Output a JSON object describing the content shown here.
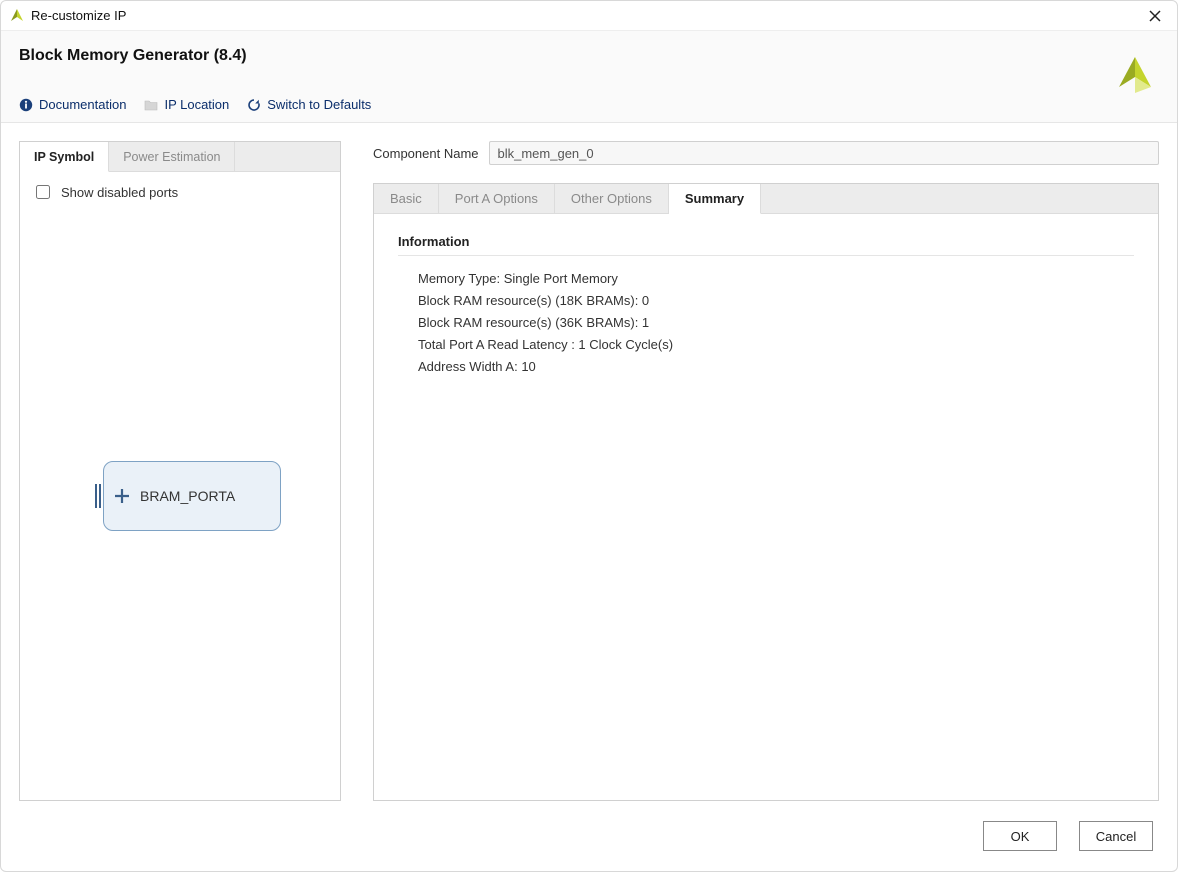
{
  "window": {
    "title": "Re-customize IP"
  },
  "header": {
    "page_title": "Block Memory Generator (8.4)"
  },
  "toolbar": {
    "documentation": "Documentation",
    "ip_location": "IP Location",
    "switch_defaults": "Switch to Defaults"
  },
  "left": {
    "tabs": {
      "ip_symbol": "IP Symbol",
      "power_est": "Power Estimation"
    },
    "show_disabled_ports": "Show disabled ports",
    "symbol": {
      "port_label": "BRAM_PORTA"
    }
  },
  "right": {
    "component_label": "Component Name",
    "component_value": "blk_mem_gen_0",
    "tabs": {
      "basic": "Basic",
      "porta": "Port A Options",
      "other": "Other Options",
      "summary": "Summary"
    },
    "section": "Information",
    "info": [
      "Memory Type: Single Port Memory",
      "Block RAM resource(s) (18K BRAMs): 0",
      "Block RAM resource(s) (36K BRAMs): 1",
      "Total Port A Read Latency : 1 Clock Cycle(s)",
      "Address Width A: 10"
    ]
  },
  "footer": {
    "ok": "OK",
    "cancel": "Cancel"
  }
}
